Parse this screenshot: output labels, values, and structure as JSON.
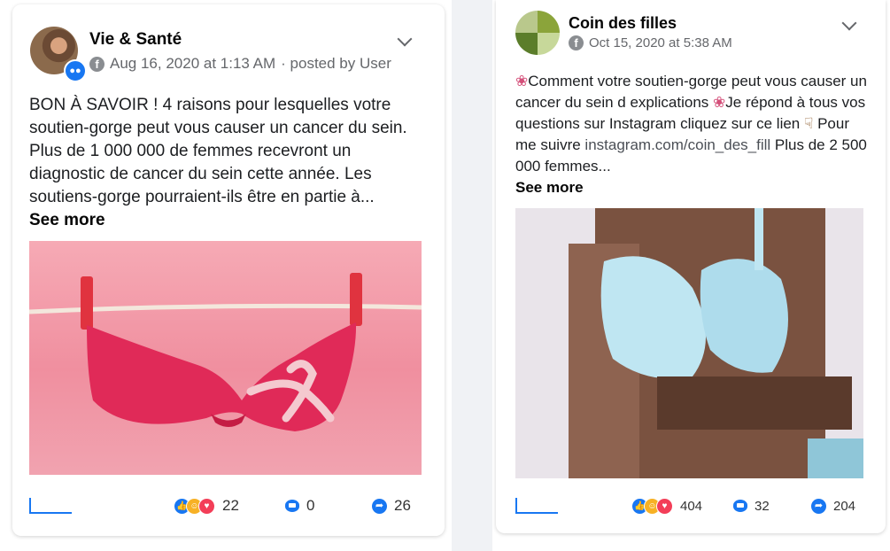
{
  "posts": [
    {
      "page_name": "Vie & Santé",
      "date": "Aug 16, 2020 at 1:13 AM",
      "posted_by": "· posted by User",
      "text": "BON À SAVOIR ! 4 raisons pour lesquelles votre soutien-gorge peut vous causer un cancer du sein. Plus de 1 000 000 de femmes recevront un diagnostic de cancer du sein cette année. Les soutiens-gorge pourraient-ils être en partie à...",
      "see_more": "See more",
      "reactions": "22",
      "comments": "0",
      "shares": "26"
    },
    {
      "page_name": "Coin des filles",
      "date": "Oct 15, 2020 at 5:38 AM",
      "text_part1": "Comment votre soutien-gorge peut vous causer un cancer du sein d explications ",
      "text_part2": "Je répond à tous vos questions sur Instagram cliquez sur ce lien ",
      "text_part3": " Pour me suivre ",
      "link": "instagram.com/coin_des_fill",
      "text_part4": " Plus de 2 500 000 femmes...",
      "see_more": "See more",
      "reactions": "404",
      "comments": "32",
      "shares": "204"
    }
  ],
  "icons": {
    "facebook": "facebook-icon",
    "chevron": "chevron-down-icon",
    "flower": "flower-emoji",
    "point_down": "pointing-down-emoji"
  },
  "colors": {
    "accent": "#1877f2",
    "meta_text": "#65676b",
    "background": "#f0f2f5"
  }
}
